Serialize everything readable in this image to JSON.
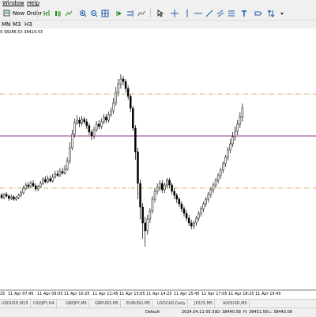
{
  "menu": {
    "window": "Window",
    "help": "Help"
  },
  "toolbar": {
    "new_order_label": "New Order",
    "icons": [
      "bar-chart",
      "candles",
      "line-chart",
      "zoom-in",
      "zoom-out",
      "tile",
      "autoscroll",
      "chart-shift",
      "cursor",
      "crosshair",
      "vertical-line",
      "horizontal-line",
      "trendline",
      "channel",
      "text",
      "label",
      "more"
    ]
  },
  "timeframes": {
    "items": [
      "MN",
      "M3",
      "H3"
    ]
  },
  "chart": {
    "header": "9 38286.53 38419.53",
    "x_labels": [
      "25",
      "11 Apr 07:45",
      "11 Apr 09:05",
      "11 Apr 10:25",
      "11 Apr 11:45",
      "11 Apr 13:05",
      "11 Apr 14:25",
      "11 Apr 15:45",
      "11 Apr 17:05",
      "11 Apr 18:25",
      "11 Apr 19:45"
    ],
    "line_color_purple": "#8b3a8b",
    "line_color_orange": "#c8a050",
    "candle_color": "#000000"
  },
  "chart_data": {
    "type": "candlestick",
    "series": [
      {
        "values": [
          [
            115,
            112,
            118,
            110
          ],
          [
            112,
            116,
            118,
            110
          ],
          [
            116,
            114,
            119,
            112
          ],
          [
            114,
            111,
            116,
            108
          ],
          [
            111,
            113,
            116,
            109
          ],
          [
            113,
            110,
            115,
            108
          ],
          [
            110,
            112,
            114,
            108
          ],
          [
            112,
            115,
            117,
            110
          ],
          [
            115,
            118,
            121,
            113
          ],
          [
            118,
            124,
            127,
            116
          ],
          [
            124,
            128,
            131,
            121
          ],
          [
            128,
            126,
            132,
            123
          ],
          [
            126,
            130,
            133,
            124
          ],
          [
            130,
            127,
            134,
            125
          ],
          [
            127,
            123,
            130,
            120
          ],
          [
            123,
            126,
            128,
            120
          ],
          [
            126,
            130,
            133,
            124
          ],
          [
            130,
            135,
            138,
            128
          ],
          [
            135,
            132,
            139,
            130
          ],
          [
            132,
            136,
            140,
            130
          ],
          [
            136,
            133,
            140,
            131
          ],
          [
            133,
            138,
            142,
            131
          ],
          [
            138,
            142,
            146,
            136
          ],
          [
            142,
            140,
            147,
            138
          ],
          [
            140,
            145,
            149,
            138
          ],
          [
            145,
            143,
            150,
            141
          ],
          [
            143,
            148,
            153,
            141
          ],
          [
            148,
            158,
            163,
            146
          ],
          [
            158,
            175,
            182,
            155
          ],
          [
            175,
            192,
            198,
            172
          ],
          [
            192,
            207,
            212,
            188
          ],
          [
            207,
            210,
            216,
            204
          ],
          [
            210,
            206,
            214,
            201
          ],
          [
            206,
            211,
            215,
            203
          ],
          [
            211,
            208,
            214,
            205
          ],
          [
            208,
            203,
            212,
            199
          ],
          [
            203,
            195,
            206,
            191
          ],
          [
            195,
            190,
            198,
            185
          ],
          [
            190,
            198,
            202,
            186
          ],
          [
            198,
            205,
            209,
            195
          ],
          [
            205,
            202,
            210,
            198
          ],
          [
            202,
            208,
            212,
            199
          ],
          [
            208,
            214,
            218,
            205
          ],
          [
            214,
            210,
            218,
            206
          ],
          [
            210,
            217,
            221,
            207
          ],
          [
            217,
            222,
            226,
            214
          ],
          [
            222,
            232,
            238,
            218
          ],
          [
            232,
            245,
            252,
            228
          ],
          [
            245,
            256,
            262,
            240
          ],
          [
            256,
            262,
            268,
            250
          ],
          [
            262,
            259,
            266,
            254
          ],
          [
            259,
            250,
            262,
            245
          ],
          [
            250,
            240,
            254,
            236
          ],
          [
            240,
            225,
            243,
            220
          ],
          [
            225,
            200,
            228,
            196
          ],
          [
            200,
            170,
            204,
            160
          ],
          [
            170,
            130,
            175,
            110
          ],
          [
            130,
            100,
            135,
            85
          ],
          [
            100,
            80,
            105,
            60
          ],
          [
            80,
            70,
            88,
            50
          ],
          [
            70,
            85,
            90,
            65
          ],
          [
            85,
            95,
            99,
            80
          ],
          [
            95,
            110,
            114,
            92
          ],
          [
            110,
            120,
            124,
            106
          ],
          [
            120,
            125,
            130,
            116
          ],
          [
            125,
            130,
            134,
            120
          ],
          [
            130,
            122,
            134,
            118
          ],
          [
            122,
            128,
            131,
            118
          ],
          [
            128,
            134,
            137,
            124
          ],
          [
            134,
            128,
            137,
            124
          ],
          [
            128,
            120,
            131,
            116
          ],
          [
            120,
            115,
            124,
            110
          ],
          [
            115,
            110,
            118,
            105
          ],
          [
            110,
            104,
            113,
            100
          ],
          [
            104,
            98,
            107,
            94
          ],
          [
            98,
            92,
            101,
            88
          ],
          [
            92,
            86,
            96,
            82
          ],
          [
            86,
            80,
            90,
            76
          ],
          [
            80,
            76,
            84,
            72
          ],
          [
            76,
            80,
            83,
            72
          ],
          [
            80,
            86,
            89,
            76
          ],
          [
            86,
            92,
            95,
            82
          ],
          [
            92,
            98,
            101,
            88
          ],
          [
            98,
            104,
            107,
            94
          ],
          [
            104,
            110,
            113,
            100
          ],
          [
            110,
            116,
            119,
            106
          ],
          [
            116,
            122,
            125,
            112
          ],
          [
            122,
            128,
            131,
            118
          ],
          [
            128,
            134,
            137,
            124
          ],
          [
            134,
            140,
            143,
            130
          ],
          [
            140,
            147,
            150,
            136
          ],
          [
            147,
            155,
            158,
            143
          ],
          [
            155,
            163,
            166,
            151
          ],
          [
            163,
            172,
            176,
            159
          ],
          [
            172,
            180,
            186,
            168
          ],
          [
            180,
            189,
            195,
            176
          ],
          [
            189,
            196,
            202,
            184
          ],
          [
            196,
            205,
            210,
            191
          ],
          [
            205,
            214,
            220,
            200
          ],
          [
            214,
            226,
            231,
            208
          ]
        ]
      }
    ],
    "purple_line_y": 172,
    "orange_line_upper_y": 119,
    "orange_line_lower_y": 238
  },
  "tabs": [
    "USDUSD,M15",
    "USDJPY,H4",
    "GBPJPY,M5",
    "GBPUSD,M5",
    "EURUSD,M5",
    "USDCAD,Daily",
    "JP225,M5",
    "AUDUSD,M5"
  ],
  "status": {
    "profile": "Default",
    "datetime": "2024.04.11 05:30",
    "o": "O: 38440.58",
    "h": "H: 38451.58",
    "l": "L: 38443.08"
  }
}
